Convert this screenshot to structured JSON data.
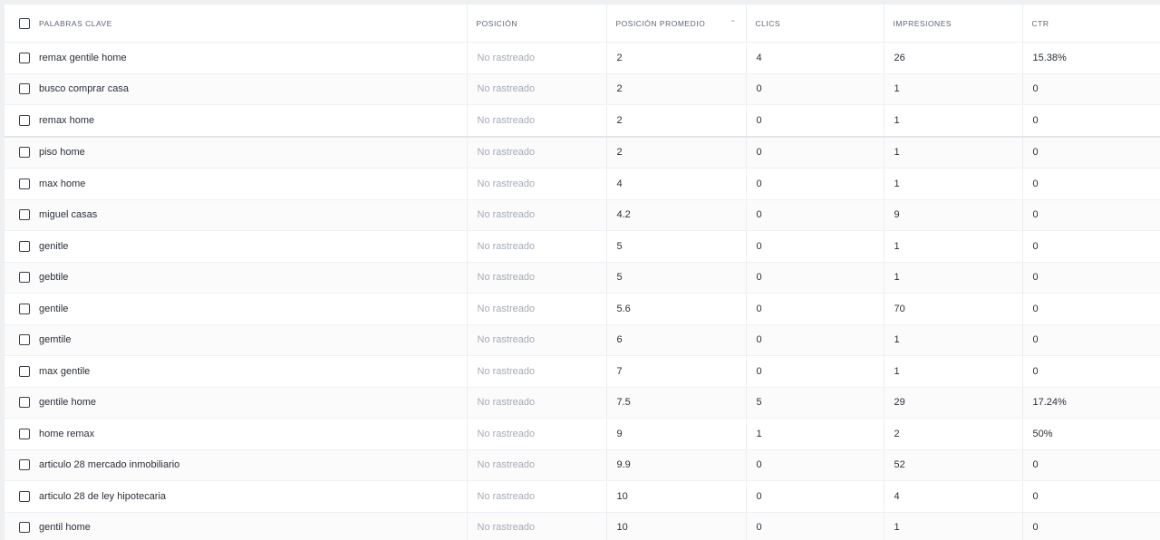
{
  "table": {
    "headers": {
      "keywords": "PALABRAS CLAVE",
      "position": "POSICIÓN",
      "avg_position": "POSICIÓN PROMEDIO",
      "clicks": "CLICS",
      "impressions": "IMPRESIONES",
      "ctr": "CTR"
    },
    "sort_icon": "chevron-up-icon",
    "rows": [
      {
        "keyword": "remax gentile home",
        "position": "No rastreado",
        "avg_position": "2",
        "clicks": "4",
        "impressions": "26",
        "ctr": "15.38%"
      },
      {
        "keyword": "busco comprar casa",
        "position": "No rastreado",
        "avg_position": "2",
        "clicks": "0",
        "impressions": "1",
        "ctr": "0"
      },
      {
        "keyword": "remax home",
        "position": "No rastreado",
        "avg_position": "2",
        "clicks": "0",
        "impressions": "1",
        "ctr": "0"
      },
      {
        "keyword": "piso home",
        "position": "No rastreado",
        "avg_position": "2",
        "clicks": "0",
        "impressions": "1",
        "ctr": "0"
      },
      {
        "keyword": "max home",
        "position": "No rastreado",
        "avg_position": "4",
        "clicks": "0",
        "impressions": "1",
        "ctr": "0"
      },
      {
        "keyword": "miguel casas",
        "position": "No rastreado",
        "avg_position": "4.2",
        "clicks": "0",
        "impressions": "9",
        "ctr": "0"
      },
      {
        "keyword": "genitle",
        "position": "No rastreado",
        "avg_position": "5",
        "clicks": "0",
        "impressions": "1",
        "ctr": "0"
      },
      {
        "keyword": "gebtile",
        "position": "No rastreado",
        "avg_position": "5",
        "clicks": "0",
        "impressions": "1",
        "ctr": "0"
      },
      {
        "keyword": "gentile",
        "position": "No rastreado",
        "avg_position": "5.6",
        "clicks": "0",
        "impressions": "70",
        "ctr": "0"
      },
      {
        "keyword": "gemtile",
        "position": "No rastreado",
        "avg_position": "6",
        "clicks": "0",
        "impressions": "1",
        "ctr": "0"
      },
      {
        "keyword": "max gentile",
        "position": "No rastreado",
        "avg_position": "7",
        "clicks": "0",
        "impressions": "1",
        "ctr": "0"
      },
      {
        "keyword": "gentile home",
        "position": "No rastreado",
        "avg_position": "7.5",
        "clicks": "5",
        "impressions": "29",
        "ctr": "17.24%"
      },
      {
        "keyword": "home remax",
        "position": "No rastreado",
        "avg_position": "9",
        "clicks": "1",
        "impressions": "2",
        "ctr": "50%"
      },
      {
        "keyword": "articulo 28 mercado inmobiliario",
        "position": "No rastreado",
        "avg_position": "9.9",
        "clicks": "0",
        "impressions": "52",
        "ctr": "0"
      },
      {
        "keyword": "articulo 28 de ley hipotecaria",
        "position": "No rastreado",
        "avg_position": "10",
        "clicks": "0",
        "impressions": "4",
        "ctr": "0"
      },
      {
        "keyword": "gentil home",
        "position": "No rastreado",
        "avg_position": "10",
        "clicks": "0",
        "impressions": "1",
        "ctr": "0"
      }
    ]
  }
}
